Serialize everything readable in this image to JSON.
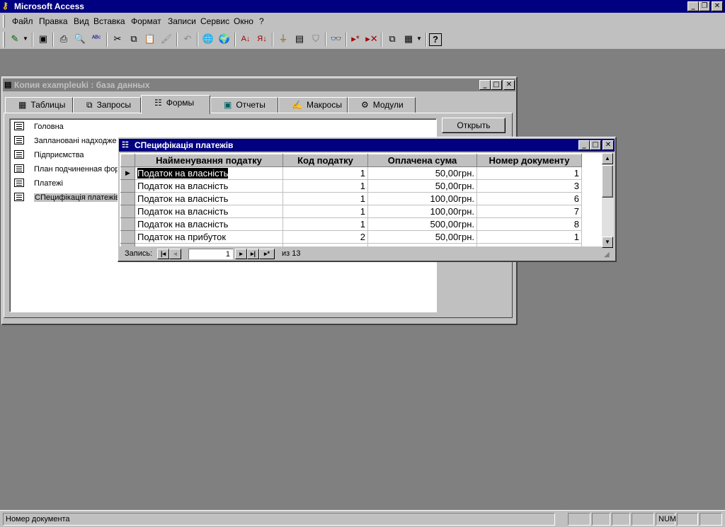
{
  "app": {
    "title": "Microsoft Access"
  },
  "menu": [
    "Файл",
    "Правка",
    "Вид",
    "Вставка",
    "Формат",
    "Записи",
    "Сервис",
    "Окно",
    "?"
  ],
  "db_window": {
    "title": "Копия exampleukі : база данных",
    "tabs": [
      "Таблицы",
      "Запросы",
      "Формы",
      "Отчеты",
      "Макросы",
      "Модули"
    ],
    "active_tab": "Формы",
    "items": [
      "Головна",
      "Заплановані надходже",
      "Підприємства",
      "План подчиненная фор",
      "Платежі",
      "СПецифікація платежів"
    ],
    "selected_item": "СПецифікація платежів",
    "open_button": "Открыть"
  },
  "form_window": {
    "title": "СПецифікація платежів",
    "columns": [
      "Найменування податку",
      "Код податку",
      "Оплачена сума",
      "Номер документу"
    ],
    "rows": [
      [
        "Податок на власність",
        "1",
        "50,00грн.",
        "1"
      ],
      [
        "Податок на власність",
        "1",
        "50,00грн.",
        "3"
      ],
      [
        "Податок на власність",
        "1",
        "100,00грн.",
        "6"
      ],
      [
        "Податок на власність",
        "1",
        "100,00грн.",
        "7"
      ],
      [
        "Податок на власність",
        "1",
        "500,00грн.",
        "8"
      ],
      [
        "Податок на прибуток",
        "2",
        "50,00грн.",
        "1"
      ]
    ],
    "record_label": "Запись:",
    "record_number": "1",
    "record_total": "из  13"
  },
  "status": {
    "text": "Номер документа",
    "num": "NUM"
  }
}
